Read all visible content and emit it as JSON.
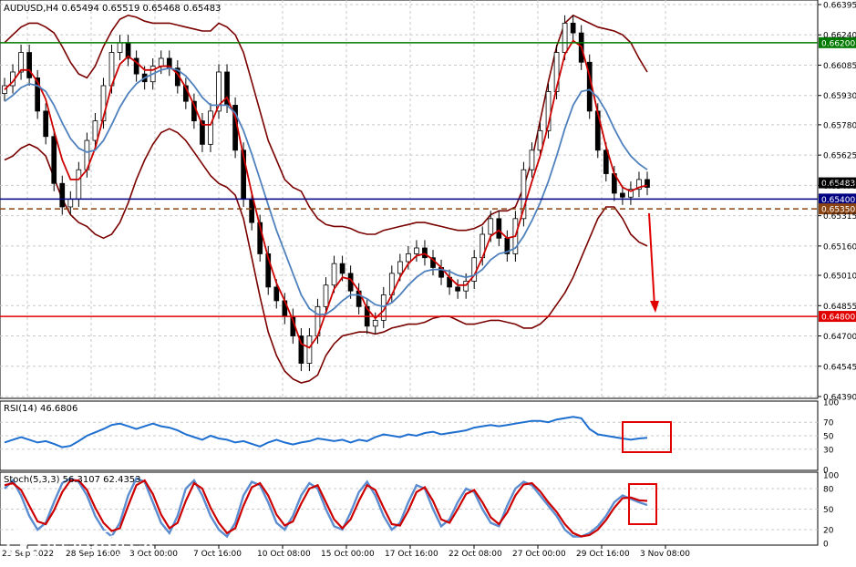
{
  "chart_data": [
    {
      "type": "line",
      "symbol_header": "AUDUSD,H4  0.65494 0.65519 0.65468 0.65483",
      "y_ticks": [
        "0.66395",
        "0.66240",
        "0.66085",
        "0.65930",
        "0.65780",
        "0.65625",
        "0.65470",
        "0.65315",
        "0.65160",
        "0.65010",
        "0.64855",
        "0.64700",
        "0.64545",
        "0.64390"
      ],
      "ylim": [
        0.6439,
        0.66395
      ],
      "x_labels": [
        "23 Sep 2022",
        "28 Sep 16:00",
        "3 Oct 00:00",
        "7 Oct 16:00",
        "10 Oct 08:00",
        "15 Oct 00:00",
        "17 Oct 16:00",
        "22 Oct 08:00",
        "27 Oct 00:00",
        "29 Oct 16:00",
        "3 Nov 08:00"
      ],
      "horizontal_levels": [
        {
          "value": 0.662,
          "label": "0.66200",
          "color": "#007a00",
          "style": "solid"
        },
        {
          "value": 0.654,
          "label": "0.65400",
          "color": "#000080",
          "style": "solid"
        },
        {
          "value": 0.6535,
          "label": "0.65350",
          "color": "#8b4513",
          "style": "dashed"
        },
        {
          "value": 0.648,
          "label": "0.64800",
          "color": "#e00000",
          "style": "solid"
        }
      ],
      "current_price": {
        "value": 0.65483,
        "label": "0.65483"
      },
      "series": [
        {
          "type": "candlestick",
          "y": [
            0.6598,
            0.6605,
            0.6615,
            0.6602,
            0.6585,
            0.6572,
            0.6548,
            0.6536,
            0.654,
            0.6555,
            0.657,
            0.658,
            0.6598,
            0.6615,
            0.662,
            0.6612,
            0.6604,
            0.66,
            0.6608,
            0.6612,
            0.6607,
            0.6598,
            0.659,
            0.658,
            0.6568,
            0.6585,
            0.6605,
            0.6588,
            0.6565,
            0.654,
            0.6528,
            0.6512,
            0.6495,
            0.6488,
            0.648,
            0.647,
            0.6456,
            0.647,
            0.6485,
            0.6496,
            0.6507,
            0.6502,
            0.6493,
            0.6485,
            0.6475,
            0.6478,
            0.6491,
            0.6502,
            0.6508,
            0.6512,
            0.6515,
            0.651,
            0.6505,
            0.65,
            0.6495,
            0.6493,
            0.6498,
            0.651,
            0.6522,
            0.653,
            0.652,
            0.6512,
            0.653,
            0.6555,
            0.6565,
            0.6575,
            0.6595,
            0.6615,
            0.663,
            0.6625,
            0.661,
            0.6585,
            0.6565,
            0.6553,
            0.6543,
            0.6541,
            0.6545,
            0.655,
            0.6546
          ],
          "color": "#000000"
        },
        {
          "name": "",
          "type": "moving_average",
          "color": "#cc0000",
          "y": [
            0.6596,
            0.66,
            0.6606,
            0.6606,
            0.66,
            0.6591,
            0.6575,
            0.656,
            0.655,
            0.655,
            0.6555,
            0.6566,
            0.6582,
            0.6598,
            0.6609,
            0.6613,
            0.661,
            0.6606,
            0.6606,
            0.6608,
            0.6608,
            0.6604,
            0.6597,
            0.6588,
            0.6578,
            0.6578,
            0.6588,
            0.6592,
            0.6582,
            0.6562,
            0.6543,
            0.6526,
            0.651,
            0.6497,
            0.6488,
            0.6478,
            0.6466,
            0.6464,
            0.647,
            0.6482,
            0.6494,
            0.65,
            0.6499,
            0.6493,
            0.6484,
            0.6479,
            0.6483,
            0.6491,
            0.65,
            0.6507,
            0.6511,
            0.6512,
            0.6509,
            0.6505,
            0.65,
            0.6496,
            0.6496,
            0.6501,
            0.651,
            0.6521,
            0.6524,
            0.652,
            0.6521,
            0.6535,
            0.6549,
            0.6562,
            0.6578,
            0.6597,
            0.6614,
            0.6621,
            0.6618,
            0.6603,
            0.6584,
            0.6567,
            0.6553,
            0.6546,
            0.6544,
            0.6546,
            0.6547
          ]
        },
        {
          "name": "",
          "type": "moving_average",
          "color": "#4f81bd",
          "y": [
            0.659,
            0.6593,
            0.6597,
            0.6599,
            0.6598,
            0.6595,
            0.6588,
            0.6579,
            0.6571,
            0.6566,
            0.6564,
            0.6565,
            0.657,
            0.6578,
            0.6587,
            0.6594,
            0.6599,
            0.6602,
            0.6604,
            0.6606,
            0.6607,
            0.6606,
            0.6603,
            0.6598,
            0.6592,
            0.6588,
            0.6588,
            0.6588,
            0.6584,
            0.6575,
            0.6563,
            0.655,
            0.6537,
            0.6524,
            0.6513,
            0.6502,
            0.6491,
            0.6484,
            0.6481,
            0.6481,
            0.6484,
            0.6488,
            0.6491,
            0.6491,
            0.6489,
            0.6486,
            0.6485,
            0.6487,
            0.6491,
            0.6496,
            0.65,
            0.6503,
            0.6504,
            0.6504,
            0.6503,
            0.6501,
            0.65,
            0.6501,
            0.6504,
            0.6509,
            0.6512,
            0.6513,
            0.6515,
            0.6521,
            0.6529,
            0.6538,
            0.6549,
            0.6562,
            0.6576,
            0.6588,
            0.6595,
            0.6596,
            0.6592,
            0.6585,
            0.6576,
            0.6568,
            0.6562,
            0.6558,
            0.6555
          ]
        },
        {
          "name": "",
          "type": "bollinger_upper",
          "color": "#7a0000",
          "y": [
            0.662,
            0.6624,
            0.6628,
            0.663,
            0.663,
            0.6628,
            0.6625,
            0.6618,
            0.661,
            0.6604,
            0.6602,
            0.6608,
            0.6618,
            0.6626,
            0.6632,
            0.6634,
            0.6633,
            0.6631,
            0.663,
            0.663,
            0.663,
            0.6629,
            0.6628,
            0.6627,
            0.6626,
            0.6626,
            0.663,
            0.6628,
            0.6624,
            0.6615,
            0.66,
            0.6585,
            0.657,
            0.656,
            0.655,
            0.6546,
            0.6544,
            0.6536,
            0.653,
            0.6527,
            0.6526,
            0.6526,
            0.6525,
            0.6523,
            0.6522,
            0.6522,
            0.6524,
            0.6525,
            0.6526,
            0.6527,
            0.6528,
            0.6528,
            0.6527,
            0.6526,
            0.6525,
            0.6524,
            0.6524,
            0.6525,
            0.6527,
            0.6532,
            0.6534,
            0.6534,
            0.6536,
            0.6546,
            0.656,
            0.658,
            0.66,
            0.6618,
            0.663,
            0.6634,
            0.6632,
            0.663,
            0.6628,
            0.6627,
            0.6626,
            0.6624,
            0.662,
            0.6612,
            0.6605
          ]
        },
        {
          "name": "",
          "type": "bollinger_lower",
          "color": "#7a0000",
          "y": [
            0.656,
            0.6562,
            0.6566,
            0.6568,
            0.6566,
            0.6562,
            0.6551,
            0.654,
            0.6532,
            0.6528,
            0.6526,
            0.6522,
            0.652,
            0.6522,
            0.6528,
            0.6538,
            0.655,
            0.656,
            0.6568,
            0.6574,
            0.6576,
            0.6574,
            0.657,
            0.6564,
            0.6558,
            0.6552,
            0.6548,
            0.6546,
            0.6542,
            0.653,
            0.651,
            0.649,
            0.6472,
            0.646,
            0.6452,
            0.6448,
            0.6446,
            0.6447,
            0.645,
            0.646,
            0.6466,
            0.647,
            0.6471,
            0.6472,
            0.6472,
            0.6471,
            0.6472,
            0.6474,
            0.6475,
            0.6476,
            0.6476,
            0.6477,
            0.6479,
            0.648,
            0.648,
            0.6478,
            0.6476,
            0.6476,
            0.6477,
            0.6478,
            0.6478,
            0.6477,
            0.6476,
            0.6474,
            0.6474,
            0.6476,
            0.648,
            0.6486,
            0.6492,
            0.65,
            0.651,
            0.652,
            0.653,
            0.6536,
            0.6536,
            0.653,
            0.6522,
            0.6518,
            0.6516
          ]
        }
      ]
    },
    {
      "type": "line",
      "label": "RSI(14) 46.6806",
      "ylim": [
        0,
        100
      ],
      "y_ticks": [
        "100",
        "70",
        "50",
        "30",
        "0"
      ],
      "levels": [
        70,
        50,
        30
      ],
      "series": [
        {
          "name": "RSI",
          "color": "#1e6fd0",
          "y": [
            40,
            44,
            48,
            44,
            40,
            42,
            38,
            33,
            35,
            42,
            50,
            55,
            60,
            66,
            68,
            64,
            60,
            64,
            68,
            64,
            62,
            58,
            52,
            48,
            44,
            50,
            46,
            44,
            40,
            42,
            38,
            34,
            40,
            44,
            40,
            37,
            40,
            42,
            46,
            44,
            42,
            44,
            40,
            44,
            42,
            48,
            52,
            50,
            48,
            52,
            50,
            54,
            56,
            52,
            54,
            56,
            58,
            62,
            64,
            66,
            64,
            66,
            68,
            70,
            72,
            72,
            70,
            74,
            76,
            78,
            76,
            60,
            52,
            50,
            48,
            46,
            44,
            46,
            47
          ]
        }
      ]
    },
    {
      "type": "line",
      "label": "Stoch(5,3,3) 56.3107 62.4353",
      "ylim": [
        0,
        100
      ],
      "y_ticks": [
        "100",
        "80",
        "50",
        "20",
        "0"
      ],
      "levels": [
        80,
        50,
        20
      ],
      "series": [
        {
          "name": "%K",
          "color": "#5b8dd0",
          "y": [
            80,
            92,
            70,
            40,
            20,
            30,
            60,
            88,
            95,
            90,
            70,
            40,
            20,
            10,
            30,
            70,
            95,
            90,
            60,
            30,
            15,
            40,
            80,
            92,
            70,
            40,
            20,
            10,
            30,
            70,
            90,
            85,
            60,
            30,
            20,
            40,
            70,
            88,
            80,
            50,
            25,
            20,
            45,
            75,
            90,
            70,
            40,
            20,
            30,
            60,
            85,
            80,
            50,
            25,
            35,
            60,
            80,
            75,
            50,
            30,
            25,
            55,
            80,
            90,
            85,
            70,
            55,
            40,
            20,
            10,
            10,
            15,
            25,
            40,
            60,
            70,
            65,
            60,
            56
          ]
        },
        {
          "name": "%D",
          "color": "#cc0000",
          "y": [
            85,
            88,
            78,
            55,
            32,
            28,
            48,
            75,
            92,
            92,
            78,
            52,
            30,
            18,
            22,
            55,
            85,
            92,
            72,
            42,
            22,
            30,
            62,
            88,
            80,
            52,
            30,
            15,
            22,
            55,
            82,
            88,
            70,
            42,
            26,
            32,
            58,
            80,
            85,
            60,
            35,
            22,
            35,
            62,
            85,
            78,
            52,
            28,
            26,
            48,
            75,
            82,
            62,
            35,
            30,
            50,
            72,
            78,
            60,
            38,
            28,
            45,
            70,
            86,
            88,
            76,
            60,
            46,
            28,
            15,
            10,
            12,
            20,
            34,
            52,
            66,
            67,
            63,
            62
          ]
        }
      ]
    }
  ],
  "watermark": {
    "brand": "instaforex",
    "tagline": "Instant Forex Trading"
  },
  "colors": {
    "axis": "#000000",
    "grid": "#c8c8c8",
    "highlight_box": "#e00000",
    "arrow": "#e00000"
  }
}
